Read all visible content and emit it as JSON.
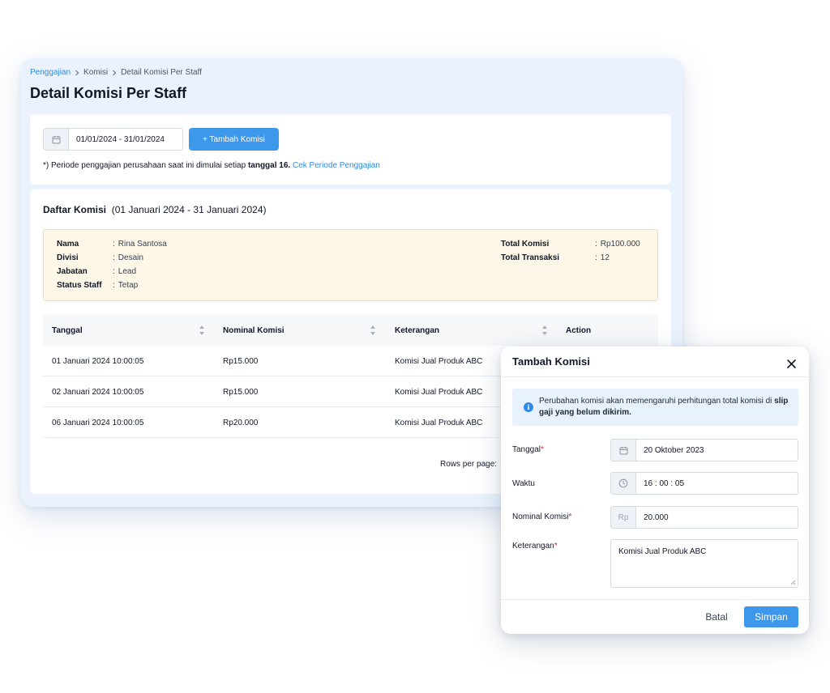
{
  "breadcrumb": {
    "root": "Penggajian",
    "middle": "Komisi",
    "current": "Detail Komisi Per Staff"
  },
  "page": {
    "title": "Detail Komisi Per Staff"
  },
  "filter": {
    "date_range": "01/01/2024 - 31/01/2024",
    "add_button": "+ Tambah Komisi",
    "note_prefix": "*) Periode penggajian perusahaan saat ini dimulai setiap ",
    "note_bold": "tanggal 16.",
    "note_link": "Cek Periode Penggajian"
  },
  "list": {
    "title": "Daftar Komisi",
    "period": "(01 Januari 2024 - 31 Januari 2024)",
    "staff": {
      "nama_label": "Nama",
      "nama": "Rina Santosa",
      "divisi_label": "Divisi",
      "divisi": "Desain",
      "jabatan_label": "Jabatan",
      "jabatan": "Lead",
      "status_label": "Status Staff",
      "status": "Tetap",
      "total_komisi_label": "Total Komisi",
      "total_komisi": "Rp100.000",
      "total_transaksi_label": "Total Transaksi",
      "total_transaksi": "12",
      "colon": ":"
    },
    "columns": [
      "Tanggal",
      "Nominal Komisi",
      "Keterangan",
      "Action"
    ],
    "rows": [
      {
        "tanggal": "01 Januari 2024 10:00:05",
        "nominal": "Rp15.000",
        "keterangan": "Komisi Jual Produk ABC"
      },
      {
        "tanggal": "02 Januari 2024 10:00:05",
        "nominal": "Rp15.000",
        "keterangan": "Komisi Jual Produk ABC"
      },
      {
        "tanggal": "06 Januari 2024 10:00:05",
        "nominal": "Rp20.000",
        "keterangan": "Komisi Jual Produk ABC"
      }
    ],
    "rows_per_page": "Rows per page:"
  },
  "modal": {
    "title": "Tambah Komisi",
    "alert_prefix": "Perubahan komisi akan memengaruhi perhitungan total komisi di ",
    "alert_bold": "slip gaji yang belum dikirim.",
    "tanggal_label": "Tanggal",
    "tanggal": "20 Oktober 2023",
    "waktu_label": "Waktu",
    "waktu": "16 : 00 : 05",
    "nominal_label": "Nominal Komisi",
    "currency": "Rp",
    "nominal": "20.000",
    "keterangan_label": "Keterangan",
    "keterangan": "Komisi Jual Produk ABC",
    "required_mark": "*",
    "cancel": "Batal",
    "save": "Simpan"
  },
  "colors": {
    "primary": "#3d97ea",
    "link": "#2e8ae6",
    "panel_bg": "#eaf3fd",
    "staff_box_bg": "#fef6e7",
    "required": "#dc2626"
  },
  "icons": [
    "calendar-icon",
    "chevron-right-icon",
    "sort-icon",
    "close-icon",
    "info-icon",
    "clock-icon"
  ]
}
